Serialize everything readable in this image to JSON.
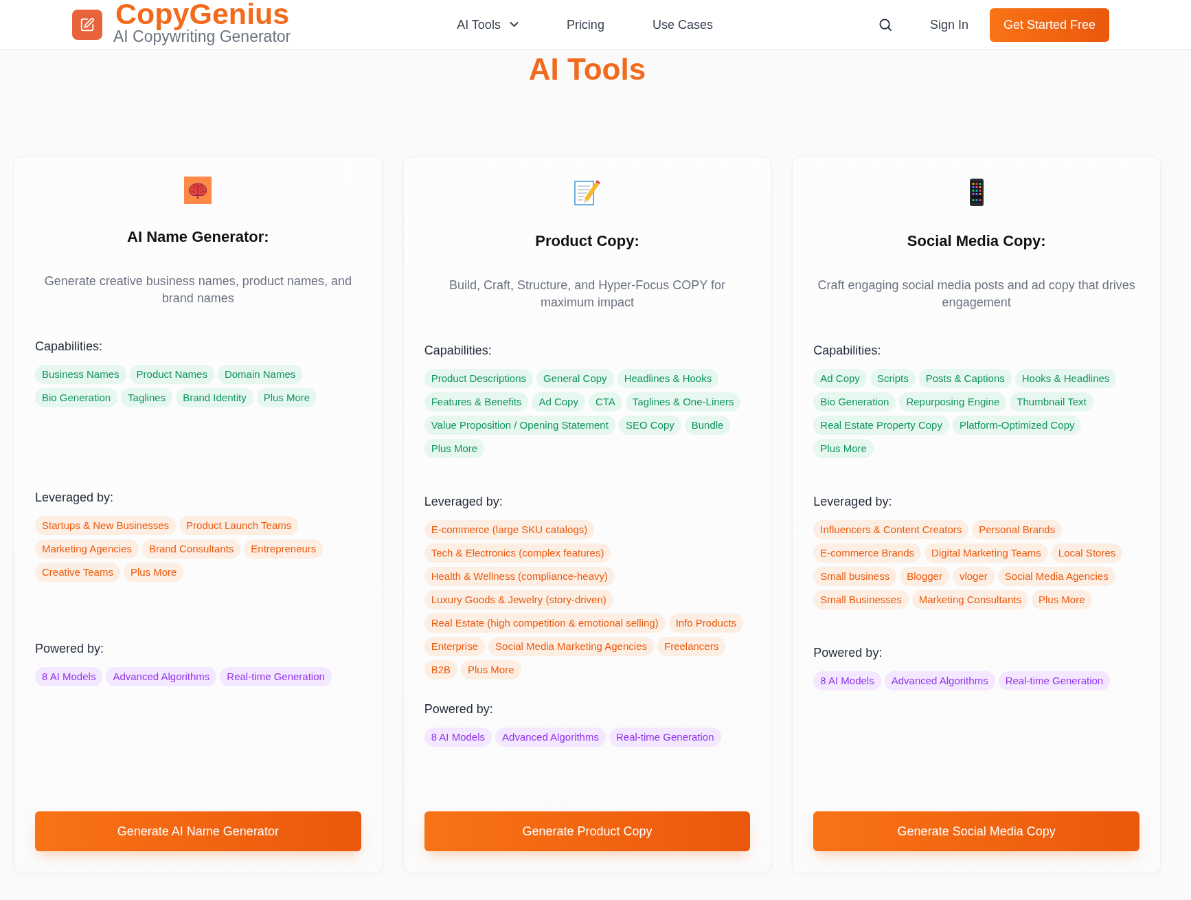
{
  "header": {
    "logo_title": "CopyGenius",
    "logo_subtitle": "AI Copywriting Generator",
    "nav": [
      {
        "label": "AI Tools",
        "kind": "dropdown"
      },
      {
        "label": "Pricing",
        "kind": "link"
      },
      {
        "label": "Use Cases",
        "kind": "link"
      }
    ],
    "sign_in": "Sign In",
    "cta": "Get Started Free"
  },
  "page_title": "AI Tools",
  "cards": [
    {
      "kind": "names",
      "title": "AI Name Generator:",
      "description": "Generate creative business names, product names, and brand names",
      "sections": [
        {
          "kind": "capabilities",
          "label": "Capabilities:",
          "tags": [
            "Business Names",
            "Product Names",
            "Domain Names",
            "Bio Generation",
            "Taglines",
            "Brand Identity",
            "Plus More"
          ]
        },
        {
          "kind": "audience",
          "label": "Leveraged by:",
          "tags": [
            "Startups & New Businesses",
            "Product Launch Teams",
            "Marketing Agencies",
            "Brand Consultants",
            "Entrepreneurs",
            "Creative Teams",
            "Plus More"
          ]
        },
        {
          "kind": "technology",
          "label": "Powered by:",
          "tags": [
            "8 AI Models",
            "Advanced Algorithms",
            "Real-time Generation"
          ]
        }
      ],
      "button": "Generate AI Name Generator"
    },
    {
      "kind": "product",
      "title": "Product Copy:",
      "description": "Build, Craft, Structure, and Hyper-Focus COPY for maximum impact",
      "sections": [
        {
          "kind": "capabilities",
          "label": "Capabilities:",
          "tags": [
            "Product Descriptions",
            "General Copy",
            "Headlines & Hooks",
            "Features & Benefits",
            "Ad Copy",
            "CTA",
            "Taglines & One-Liners",
            "Value Proposition / Opening Statement",
            "SEO Copy",
            "Bundle",
            "Plus More"
          ]
        },
        {
          "kind": "audience",
          "label": "Leveraged by:",
          "tags": [
            "E-commerce (large SKU catalogs)",
            "Tech & Electronics (complex features)",
            "Health & Wellness (compliance-heavy)",
            "Luxury Goods & Jewelry (story-driven)",
            "Real Estate (high competition & emotional selling)",
            "Info Products",
            "Enterprise",
            "Social Media Marketing Agencies",
            "Freelancers",
            "B2B",
            "Plus More"
          ]
        },
        {
          "kind": "technology",
          "label": "Powered by:",
          "tags": [
            "8 AI Models",
            "Advanced Algorithms",
            "Real-time Generation"
          ]
        }
      ],
      "button": "Generate Product Copy"
    },
    {
      "kind": "social",
      "title": "Social Media Copy:",
      "description": "Craft engaging social media posts and ad copy that drives engagement",
      "sections": [
        {
          "kind": "capabilities",
          "label": "Capabilities:",
          "tags": [
            "Ad Copy",
            "Scripts",
            "Posts & Captions",
            "Hooks & Headlines",
            "Bio Generation",
            "Repurposing Engine",
            "Thumbnail Text",
            "Real Estate Property Copy",
            "Platform-Optimized Copy",
            "Plus More"
          ]
        },
        {
          "kind": "audience",
          "label": "Leveraged by:",
          "tags": [
            "Influencers & Content Creators",
            "Personal Brands",
            "E-commerce Brands",
            "Digital Marketing Teams",
            "Local Stores",
            "Small business",
            "Blogger",
            "vloger",
            "Social Media Agencies",
            "Small Businesses",
            "Marketing Consultants",
            "Plus More"
          ]
        },
        {
          "kind": "technology",
          "label": "Powered by:",
          "tags": [
            "8 AI Models",
            "Advanced Algorithms",
            "Real-time Generation"
          ]
        }
      ],
      "button": "Generate Social Media Copy"
    }
  ]
}
